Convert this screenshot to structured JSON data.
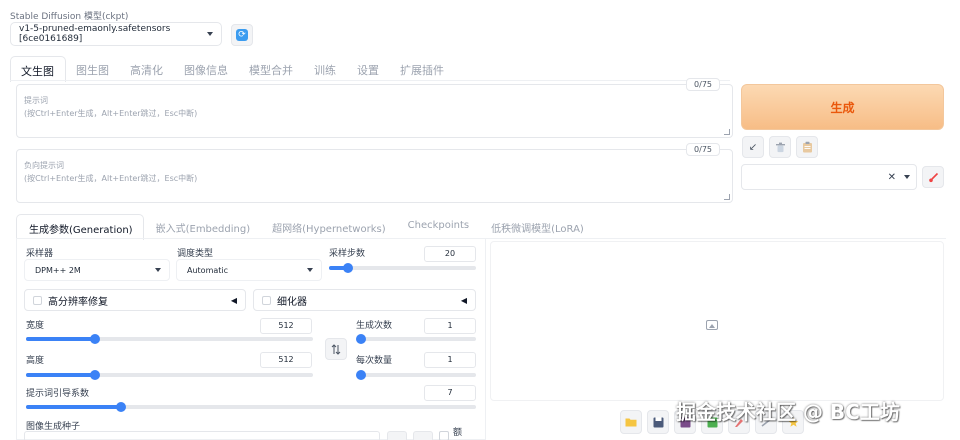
{
  "model": {
    "label": "Stable Diffusion 模型(ckpt)",
    "selected": "v1-5-pruned-emaonly.safetensors [6ce0161689]"
  },
  "main_tabs": [
    {
      "label": "文生图",
      "active": true
    },
    {
      "label": "图生图"
    },
    {
      "label": "高清化"
    },
    {
      "label": "图像信息"
    },
    {
      "label": "模型合并"
    },
    {
      "label": "训练"
    },
    {
      "label": "设置"
    },
    {
      "label": "扩展插件"
    }
  ],
  "prompt": {
    "placeholder_line1": "提示词",
    "placeholder_line2": "(按Ctrl+Enter生成，Alt+Enter跳过，Esc中断)",
    "counter": "0/75"
  },
  "negative_prompt": {
    "placeholder_line1": "负向提示词",
    "placeholder_line2": "(按Ctrl+Enter生成，Alt+Enter跳过，Esc中断)",
    "counter": "0/75"
  },
  "generate_label": "生成",
  "style_clear": "✕",
  "sub_tabs": [
    {
      "label": "生成参数(Generation)",
      "active": true
    },
    {
      "label": "嵌入式(Embedding)"
    },
    {
      "label": "超网络(Hypernetworks)"
    },
    {
      "label": "Checkpoints"
    },
    {
      "label": "低秩微调模型(LoRA)"
    }
  ],
  "params": {
    "sampler_label": "采样器",
    "sampler_value": "DPM++ 2M",
    "schedule_label": "调度类型",
    "schedule_value": "Automatic",
    "steps_label": "采样步数",
    "steps_value": "20",
    "hires_label": "高分辨率修复",
    "refiner_label": "细化器",
    "width_label": "宽度",
    "width_value": "512",
    "height_label": "高度",
    "height_value": "512",
    "batch_count_label": "生成次数",
    "batch_count_value": "1",
    "batch_size_label": "每次数量",
    "batch_size_value": "1",
    "cfg_label": "提示词引导系数",
    "cfg_value": "7",
    "seed_label": "图像生成种子",
    "seed_extra": "额"
  },
  "slider_levels": {
    "steps": 0.13,
    "width": 0.24,
    "height": 0.24,
    "batch_count": 0.0,
    "batch_size": 0.0,
    "cfg": 0.21
  },
  "icons": {
    "refresh": "refresh-icon",
    "arrow": "↙",
    "trash": "trash-icon",
    "clipboard": "clipboard-icon",
    "brush": "brush-icon",
    "swap": "swap-icon",
    "image_placeholder": "image-icon",
    "outputs": [
      "folder-icon",
      "save-icon",
      "zip-icon",
      "send-img2img-icon",
      "send-inpaint-icon",
      "send-extras-icon",
      "star-icon"
    ]
  },
  "colors": {
    "accent": "#3b82f6",
    "generate_bg": "#f7bd86",
    "generate_text": "#ea580c"
  },
  "watermark": "掘金技术社区 @ BC工坊"
}
